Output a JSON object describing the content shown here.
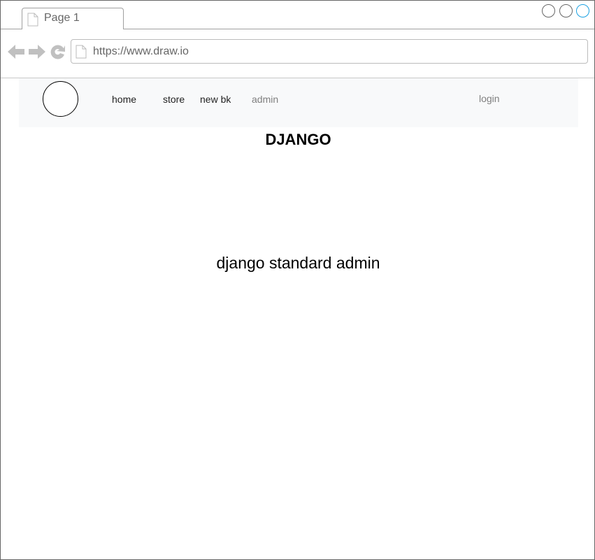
{
  "browser": {
    "tab": {
      "label": "Page 1"
    },
    "address": {
      "url": "https://www.draw.io"
    },
    "window_buttons": [
      "minimize-button",
      "maximize-button",
      "close-button"
    ],
    "colors": {
      "active_button": "#1ba1e2",
      "icon_gray": "#c0c0c0"
    }
  },
  "navbar": {
    "links": [
      {
        "label": "home"
      },
      {
        "label": "store"
      },
      {
        "label": "new bk"
      },
      {
        "label": "admin"
      }
    ],
    "login_label": "login",
    "background": "#f8f9fa"
  },
  "page": {
    "title": "DJANGO",
    "content": "django standard admin"
  }
}
